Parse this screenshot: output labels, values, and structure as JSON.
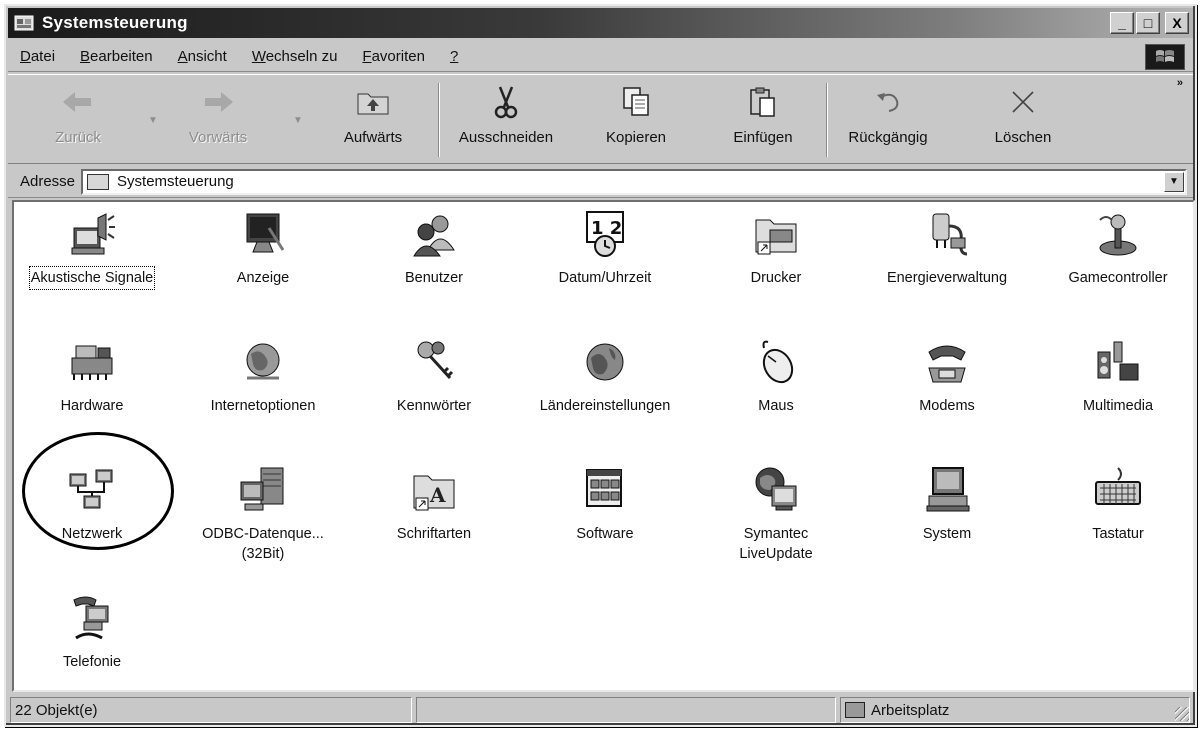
{
  "window": {
    "title": "Systemsteuerung"
  },
  "title_buttons": [
    "_",
    "□",
    "X"
  ],
  "menu": [
    {
      "pre": "",
      "u": "D",
      "post": "atei"
    },
    {
      "pre": "",
      "u": "B",
      "post": "earbeiten"
    },
    {
      "pre": "",
      "u": "A",
      "post": "nsicht"
    },
    {
      "pre": "",
      "u": "W",
      "post": "echseln zu"
    },
    {
      "pre": "",
      "u": "F",
      "post": "avoriten"
    },
    {
      "pre": "",
      "u": "?",
      "post": ""
    }
  ],
  "toolbar": {
    "back": "Zurück",
    "forward": "Vorwärts",
    "up": "Aufwärts",
    "cut": "Ausschneiden",
    "copy": "Kopieren",
    "paste": "Einfügen",
    "undo": "Rückgängig",
    "delete": "Löschen",
    "more": "»"
  },
  "address": {
    "label": "Adresse",
    "value": "Systemsteuerung"
  },
  "items": [
    {
      "label": "Akustische Signale",
      "icon": "speaker-computer-icon",
      "selected": true
    },
    {
      "label": "Anzeige",
      "icon": "display-monitor-icon"
    },
    {
      "label": "Benutzer",
      "icon": "users-icon"
    },
    {
      "label": "Datum/Uhrzeit",
      "icon": "calendar-clock-icon"
    },
    {
      "label": "Drucker",
      "icon": "printer-folder-icon"
    },
    {
      "label": "Energieverwaltung",
      "icon": "power-plug-icon"
    },
    {
      "label": "Gamecontroller",
      "icon": "joystick-icon"
    },
    {
      "label": "Hardware",
      "icon": "hardware-icon"
    },
    {
      "label": "Internetoptionen",
      "icon": "globe-icon"
    },
    {
      "label": "Kennwörter",
      "icon": "keys-icon"
    },
    {
      "label": "Ländereinstellungen",
      "icon": "world-icon"
    },
    {
      "label": "Maus",
      "icon": "mouse-icon"
    },
    {
      "label": "Modems",
      "icon": "telephone-modem-icon"
    },
    {
      "label": "Multimedia",
      "icon": "multimedia-icon"
    },
    {
      "label": "Netzwerk",
      "icon": "network-icon"
    },
    {
      "label": "ODBC-Datenque...\n(32Bit)",
      "icon": "database-icon"
    },
    {
      "label": "Schriftarten",
      "icon": "fonts-folder-icon"
    },
    {
      "label": "Software",
      "icon": "software-icon"
    },
    {
      "label": "Symantec\nLiveUpdate",
      "icon": "liveupdate-icon"
    },
    {
      "label": "System",
      "icon": "system-computer-icon"
    },
    {
      "label": "Tastatur",
      "icon": "keyboard-icon"
    },
    {
      "label": "Telefonie",
      "icon": "telephony-icon"
    }
  ],
  "status": {
    "count": "22 Objekt(e)",
    "location": "Arbeitsplatz"
  }
}
